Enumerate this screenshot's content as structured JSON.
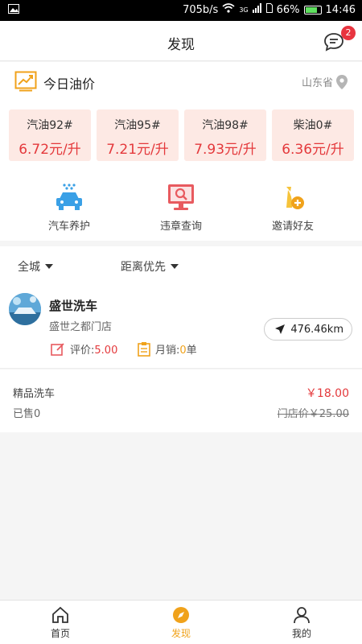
{
  "status": {
    "speed": "705b/s",
    "net": "3G",
    "battery": "66%",
    "time": "14:46"
  },
  "header": {
    "title": "发现",
    "message_badge": "2"
  },
  "oil": {
    "title": "今日油价",
    "province": "山东省",
    "prices": [
      {
        "name": "汽油92#",
        "price": "6.72元/升"
      },
      {
        "name": "汽油95#",
        "price": "7.21元/升"
      },
      {
        "name": "汽油98#",
        "price": "7.93元/升"
      },
      {
        "name": "柴油0#",
        "price": "6.36元/升"
      }
    ]
  },
  "services": [
    {
      "label": "汽车养护",
      "icon": "car-wash-icon"
    },
    {
      "label": "违章查询",
      "icon": "monitor-search-icon"
    },
    {
      "label": "邀请好友",
      "icon": "invite-friend-icon"
    }
  ],
  "filters": {
    "area": "全城",
    "sort": "距离优先"
  },
  "shop": {
    "name": "盛世洗车",
    "address": "盛世之都门店",
    "distance": "476.46km",
    "rating_label": "评价:",
    "rating": "5.00",
    "sales_label": "月销:",
    "sales": "0",
    "sales_unit": "单"
  },
  "product": {
    "name": "精品洗车",
    "sold": "已售0",
    "price": "￥18.00",
    "original_price": "门店价￥25.00"
  },
  "tabs": [
    {
      "label": "首页",
      "icon": "home-icon"
    },
    {
      "label": "发现",
      "icon": "compass-icon"
    },
    {
      "label": "我的",
      "icon": "user-icon"
    }
  ],
  "colors": {
    "accent": "#f0a21b",
    "price_red": "#e4393c",
    "card_bg": "#fde9e4"
  }
}
